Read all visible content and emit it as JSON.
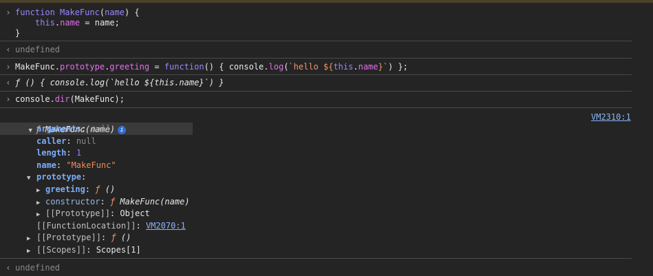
{
  "console": {
    "input1": {
      "line1": [
        "function",
        " ",
        "MakeFunc",
        "(",
        "name",
        ") {"
      ],
      "line2": [
        "this",
        ".",
        "name",
        " = name;"
      ],
      "line3": "}"
    },
    "output1": "undefined",
    "input2": [
      "MakeFunc.",
      "prototype",
      ".",
      "greeting",
      " = ",
      "function",
      "() { console.",
      "log",
      "(",
      "`hello ${",
      "this",
      ".",
      "name",
      "}`",
      ") };"
    ],
    "output2": "ƒ () { console.log(`hello ${this.name}`) }",
    "input3": [
      "console.",
      "dir",
      "(MakeFunc);"
    ],
    "dir_result": {
      "header_f": "ƒ",
      "header_name": "MakeFunc(name)",
      "info_label": "i",
      "source_link": "VM2310:1",
      "rows": {
        "arguments_key": "arguments",
        "arguments_val": "null",
        "caller_key": "caller",
        "caller_val": "null",
        "length_key": "length",
        "length_val": "1",
        "name_key": "name",
        "name_val": "\"MakeFunc\"",
        "prototype_key": "prototype",
        "greeting_key": "greeting",
        "greeting_f": "ƒ",
        "greeting_val": "()",
        "constructor_key": "constructor",
        "constructor_f": "ƒ",
        "constructor_val": "MakeFunc(name)",
        "proto_inner_key": "[[Prototype]]",
        "proto_inner_val": "Object",
        "funcloc_key": "[[FunctionLocation]]",
        "funcloc_val": "VM2070:1",
        "proto_outer_key": "[[Prototype]]",
        "proto_outer_f": "ƒ",
        "proto_outer_val": "()",
        "scopes_key": "[[Scopes]]",
        "scopes_val": "Scopes[1]"
      }
    },
    "output3": "undefined"
  },
  "icons": {
    "input_prompt": "›",
    "output_prompt": "‹",
    "expanded": "▼",
    "collapsed": "▶"
  },
  "colors": {
    "background": "#242424",
    "keyword": "#9b86ff",
    "property": "#e36eec",
    "string": "#f29766",
    "link": "#8ab4f8"
  }
}
